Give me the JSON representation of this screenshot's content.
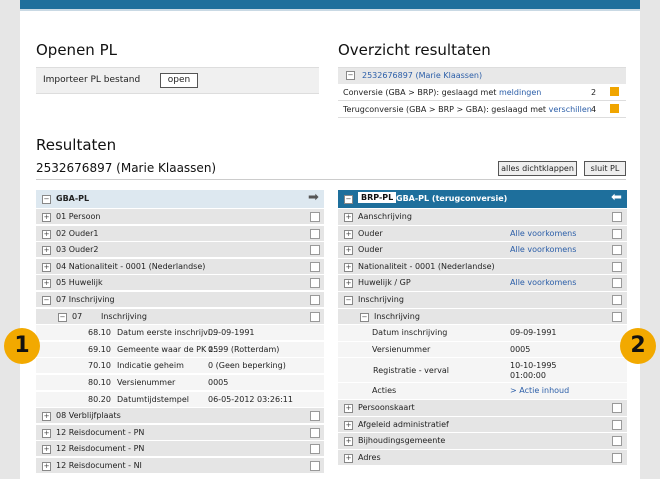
{
  "open_pl": {
    "title": "Openen PL",
    "import_label": "Importeer PL bestand",
    "open_button": "open"
  },
  "overview": {
    "title": "Overzicht resultaten",
    "header_link": "2532676897 (Marie Klaassen)",
    "rows": [
      {
        "text": "Conversie (GBA > BRP): geslaagd met ",
        "link": "meldingen",
        "count": "2",
        "color": "#f0a500"
      },
      {
        "text": "Terugconversie (GBA > BRP > GBA): geslaagd met ",
        "link": "verschillen",
        "count": "4",
        "color": "#f0a500"
      }
    ]
  },
  "results": {
    "title": "Resultaten",
    "person": "2532676897 (Marie Klaassen)",
    "collapse_button": "alles dichtklappen",
    "close_button": "sluit PL"
  },
  "left_panel": {
    "title": "GBA-PL",
    "arrow_icon": "arrow-right-icon",
    "rows": [
      {
        "sign": "+",
        "label": "01 Persoon"
      },
      {
        "sign": "+",
        "label": "02 Ouder1"
      },
      {
        "sign": "+",
        "label": "03 Ouder2"
      },
      {
        "sign": "+",
        "label": "04 Nationaliteit - 0001 (Nederlandse)"
      },
      {
        "sign": "+",
        "label": "05 Huwelijk"
      },
      {
        "sign": "-",
        "label": "07 Inschrijving"
      },
      {
        "sign": "-",
        "label": "07",
        "sub": "Inschrijving"
      },
      {
        "code": "68.10",
        "label": "Datum eerste inschrijvi...",
        "value": "09-09-1991"
      },
      {
        "code": "69.10",
        "label": "Gemeente waar de PK z...",
        "value": "0599 (Rotterdam)"
      },
      {
        "code": "70.10",
        "label": "Indicatie geheim",
        "value": "0 (Geen beperking)"
      },
      {
        "code": "80.10",
        "label": "Versienummer",
        "value": "0005"
      },
      {
        "code": "80.20",
        "label": "Datumtijdstempel",
        "value": "06-05-2012 03:26:11"
      },
      {
        "sign": "+",
        "label": "08 Verblijfplaats"
      },
      {
        "sign": "+",
        "label": "12 Reisdocument - PN"
      },
      {
        "sign": "+",
        "label": "12 Reisdocument - PN"
      },
      {
        "sign": "+",
        "label": "12 Reisdocument - NI"
      }
    ]
  },
  "right_panel": {
    "badge": "BRP-PL",
    "title": "GBA-PL (terugconversie)",
    "arrow_icon": "arrow-left-icon",
    "rows": [
      {
        "sign": "+",
        "label": "Aanschrijving"
      },
      {
        "sign": "+",
        "label": "Ouder",
        "link": "Alle voorkomens"
      },
      {
        "sign": "+",
        "label": "Ouder",
        "link": "Alle voorkomens"
      },
      {
        "sign": "+",
        "label": "Nationaliteit - 0001 (Nederlandse)"
      },
      {
        "sign": "+",
        "label": "Huwelijk / GP",
        "link": "Alle voorkomens"
      },
      {
        "sign": "-",
        "label": "Inschrijving"
      },
      {
        "sign": "-",
        "label": "Inschrijving",
        "indent": true
      },
      {
        "label": "Datum inschrijving",
        "value": "09-09-1991"
      },
      {
        "label": "Versienummer",
        "value": "0005"
      },
      {
        "label": "Registratie - verval",
        "value": "10-10-1995",
        "value2": "01:00:00"
      },
      {
        "label": "Acties",
        "link": "> Actie inhoud"
      },
      {
        "sign": "+",
        "label": "Persoonskaart"
      },
      {
        "sign": "+",
        "label": "Afgeleid administratief"
      },
      {
        "sign": "+",
        "label": "Bijhoudingsgemeente"
      },
      {
        "sign": "+",
        "label": "Adres"
      }
    ]
  },
  "callouts": {
    "left": "1",
    "right": "2"
  }
}
